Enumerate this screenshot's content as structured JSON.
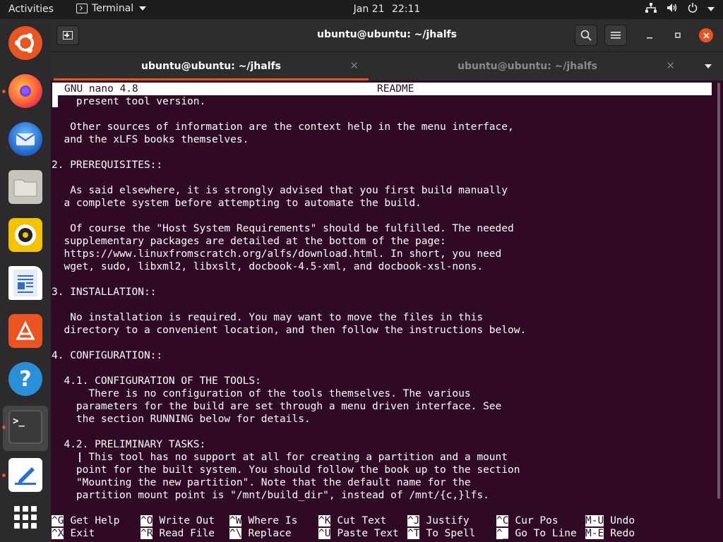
{
  "topbar": {
    "activities": "Activities",
    "app_menu": "Terminal",
    "date": "Jan 21",
    "time": "22:11"
  },
  "dock": {
    "items": [
      {
        "name": "Ubuntu Software Updater",
        "icon": "ubuntu-icon",
        "color": "#e95420"
      },
      {
        "name": "Firefox",
        "icon": "firefox-icon",
        "color": "#ff7139"
      },
      {
        "name": "Thunderbird",
        "icon": "thunderbird-icon",
        "color": "#2a6fd6"
      },
      {
        "name": "Files",
        "icon": "files-icon",
        "color": "#c9c4bc"
      },
      {
        "name": "Rhythmbox",
        "icon": "rhythmbox-icon",
        "color": "#f3c300"
      },
      {
        "name": "LibreOffice Writer",
        "icon": "writer-icon",
        "color": "#2f6ec4"
      },
      {
        "name": "Ubuntu Software",
        "icon": "software-icon",
        "color": "#e95420"
      },
      {
        "name": "Help",
        "icon": "help-icon",
        "color": "#2a8fd6"
      },
      {
        "name": "Terminal",
        "icon": "terminal-icon",
        "color": "#3a3a3a"
      },
      {
        "name": "Text Editor",
        "icon": "text-editor-icon",
        "color": "#ffffff"
      }
    ]
  },
  "window": {
    "title": "ubuntu@ubuntu: ~/jhalfs",
    "tabs": [
      {
        "label": "ubuntu@ubuntu: ~/jhalfs",
        "active": true
      },
      {
        "label": "ubuntu@ubuntu: ~/jhalfs",
        "active": false
      }
    ]
  },
  "nano": {
    "version": "GNU nano 4.8",
    "filename": "README",
    "lines": [
      "    present tool version.",
      "",
      "   Other sources of information are the context help in the menu interface,",
      "  and the xLFS books themselves.",
      "",
      "2. PREREQUISITES::",
      "",
      "   As said elsewhere, it is strongly advised that you first build manually",
      "  a complete system before attempting to automate the build.",
      "",
      "   Of course the \"Host System Requirements\" should be fulfilled. The needed",
      "  supplementary packages are detailed at the bottom of the page:",
      "  https://www.linuxfromscratch.org/alfs/download.html. In short, you need",
      "  wget, sudo, libxml2, libxslt, docbook-4.5-xml, and docbook-xsl-nons.",
      "",
      "3. INSTALLATION::",
      "",
      "   No installation is required. You may want to move the files in this",
      "  directory to a convenient location, and then follow the instructions below.",
      "",
      "4. CONFIGURATION::",
      "",
      "  4.1. CONFIGURATION OF THE TOOLS:",
      "      There is no configuration of the tools themselves. The various",
      "    parameters for the build are set through a menu driven interface. See",
      "    the section RUNNING below for details.",
      "",
      "  4.2. PRELIMINARY TASKS:",
      "      This tool has no support at all for creating a partition and a mount",
      "    point for the built system. You should follow the book up to the section",
      "    \"Mounting the new partition\". Note that the default name for the",
      "    partition mount point is \"/mnt/build_dir\", instead of /mnt/{c,}lfs."
    ],
    "shortcuts_row1": [
      {
        "key": "^G",
        "label": "Get Help"
      },
      {
        "key": "^O",
        "label": "Write Out"
      },
      {
        "key": "^W",
        "label": "Where Is"
      },
      {
        "key": "^K",
        "label": "Cut Text"
      },
      {
        "key": "^J",
        "label": "Justify"
      },
      {
        "key": "^C",
        "label": "Cur Pos"
      },
      {
        "key": "M-U",
        "label": "Undo"
      }
    ],
    "shortcuts_row2": [
      {
        "key": "^X",
        "label": "Exit"
      },
      {
        "key": "^R",
        "label": "Read File"
      },
      {
        "key": "^\\",
        "label": "Replace"
      },
      {
        "key": "^U",
        "label": "Paste Text"
      },
      {
        "key": "^T",
        "label": "To Spell"
      },
      {
        "key": "^_",
        "label": "Go To Line"
      },
      {
        "key": "M-E",
        "label": "Redo"
      }
    ]
  }
}
